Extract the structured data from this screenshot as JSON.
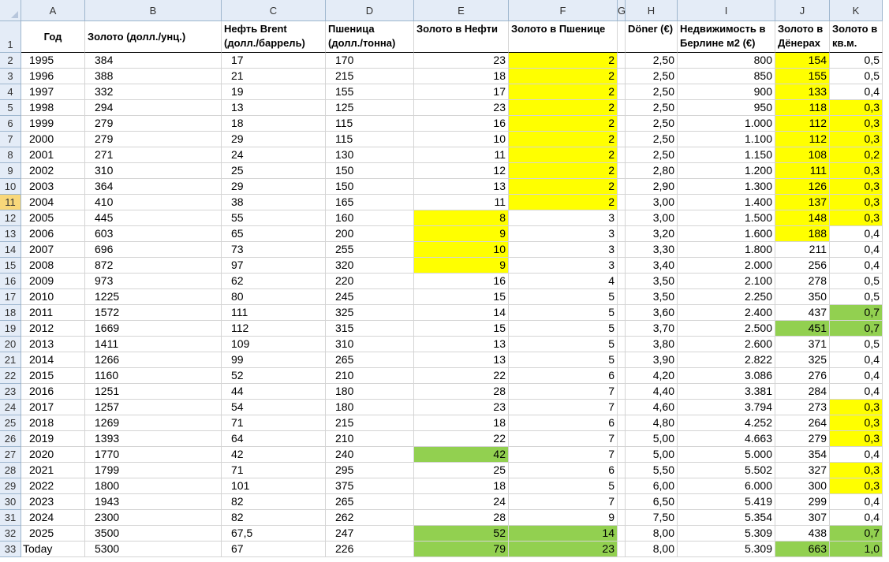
{
  "columns": [
    "A",
    "B",
    "C",
    "D",
    "E",
    "F",
    "G",
    "H",
    "I",
    "J",
    "K"
  ],
  "headers": {
    "A": "Год",
    "B": "Золото (долл./унц.)",
    "C": "Нефть Brent (долл./баррель)",
    "D": "Пшеница (долл./тонна)",
    "E": "Золото в Нефти",
    "F": "Золото в Пшенице",
    "G": "",
    "H": "Döner (€)",
    "I": "Недвижимость в Берлине м2 (€)",
    "J": "Золото в Дёнерах",
    "K": "Золото в кв.м."
  },
  "row_numbers": [
    "1",
    "2",
    "3",
    "4",
    "5",
    "6",
    "7",
    "8",
    "9",
    "10",
    "11",
    "12",
    "13",
    "14",
    "15",
    "16",
    "17",
    "18",
    "19",
    "20",
    "21",
    "22",
    "23",
    "24",
    "25",
    "26",
    "27",
    "28",
    "29",
    "30",
    "31",
    "32",
    "33"
  ],
  "active_row": "11",
  "colors": {
    "yellow": "#ffff00",
    "green": "#92d050",
    "header_bg": "#e4ecf7",
    "active_header": "#f8d77a"
  },
  "rows": [
    [
      "1995",
      "384",
      "17",
      "170",
      "23",
      "2",
      "2,50",
      "800",
      "154",
      "0,5"
    ],
    [
      "1996",
      "388",
      "21",
      "215",
      "18",
      "2",
      "2,50",
      "850",
      "155",
      "0,5"
    ],
    [
      "1997",
      "332",
      "19",
      "155",
      "17",
      "2",
      "2,50",
      "900",
      "133",
      "0,4"
    ],
    [
      "1998",
      "294",
      "13",
      "125",
      "23",
      "2",
      "2,50",
      "950",
      "118",
      "0,3"
    ],
    [
      "1999",
      "279",
      "18",
      "115",
      "16",
      "2",
      "2,50",
      "1.000",
      "112",
      "0,3"
    ],
    [
      "2000",
      "279",
      "29",
      "115",
      "10",
      "2",
      "2,50",
      "1.100",
      "112",
      "0,3"
    ],
    [
      "2001",
      "271",
      "24",
      "130",
      "11",
      "2",
      "2,50",
      "1.150",
      "108",
      "0,2"
    ],
    [
      "2002",
      "310",
      "25",
      "150",
      "12",
      "2",
      "2,80",
      "1.200",
      "111",
      "0,3"
    ],
    [
      "2003",
      "364",
      "29",
      "150",
      "13",
      "2",
      "2,90",
      "1.300",
      "126",
      "0,3"
    ],
    [
      "2004",
      "410",
      "38",
      "165",
      "11",
      "2",
      "3,00",
      "1.400",
      "137",
      "0,3"
    ],
    [
      "2005",
      "445",
      "55",
      "160",
      "8",
      "3",
      "3,00",
      "1.500",
      "148",
      "0,3"
    ],
    [
      "2006",
      "603",
      "65",
      "200",
      "9",
      "3",
      "3,20",
      "1.600",
      "188",
      "0,4"
    ],
    [
      "2007",
      "696",
      "73",
      "255",
      "10",
      "3",
      "3,30",
      "1.800",
      "211",
      "0,4"
    ],
    [
      "2008",
      "872",
      "97",
      "320",
      "9",
      "3",
      "3,40",
      "2.000",
      "256",
      "0,4"
    ],
    [
      "2009",
      "973",
      "62",
      "220",
      "16",
      "4",
      "3,50",
      "2.100",
      "278",
      "0,5"
    ],
    [
      "2010",
      "1225",
      "80",
      "245",
      "15",
      "5",
      "3,50",
      "2.250",
      "350",
      "0,5"
    ],
    [
      "2011",
      "1572",
      "111",
      "325",
      "14",
      "5",
      "3,60",
      "2.400",
      "437",
      "0,7"
    ],
    [
      "2012",
      "1669",
      "112",
      "315",
      "15",
      "5",
      "3,70",
      "2.500",
      "451",
      "0,7"
    ],
    [
      "2013",
      "1411",
      "109",
      "310",
      "13",
      "5",
      "3,80",
      "2.600",
      "371",
      "0,5"
    ],
    [
      "2014",
      "1266",
      "99",
      "265",
      "13",
      "5",
      "3,90",
      "2.822",
      "325",
      "0,4"
    ],
    [
      "2015",
      "1160",
      "52",
      "210",
      "22",
      "6",
      "4,20",
      "3.086",
      "276",
      "0,4"
    ],
    [
      "2016",
      "1251",
      "44",
      "180",
      "28",
      "7",
      "4,40",
      "3.381",
      "284",
      "0,4"
    ],
    [
      "2017",
      "1257",
      "54",
      "180",
      "23",
      "7",
      "4,60",
      "3.794",
      "273",
      "0,3"
    ],
    [
      "2018",
      "1269",
      "71",
      "215",
      "18",
      "6",
      "4,80",
      "4.252",
      "264",
      "0,3"
    ],
    [
      "2019",
      "1393",
      "64",
      "210",
      "22",
      "7",
      "5,00",
      "4.663",
      "279",
      "0,3"
    ],
    [
      "2020",
      "1770",
      "42",
      "240",
      "42",
      "7",
      "5,00",
      "5.000",
      "354",
      "0,4"
    ],
    [
      "2021",
      "1799",
      "71",
      "295",
      "25",
      "6",
      "5,50",
      "5.502",
      "327",
      "0,3"
    ],
    [
      "2022",
      "1800",
      "101",
      "375",
      "18",
      "5",
      "6,00",
      "6.000",
      "300",
      "0,3"
    ],
    [
      "2023",
      "1943",
      "82",
      "265",
      "24",
      "7",
      "6,50",
      "5.419",
      "299",
      "0,4"
    ],
    [
      "2024",
      "2300",
      "82",
      "262",
      "28",
      "9",
      "7,50",
      "5.354",
      "307",
      "0,4"
    ],
    [
      "2025",
      "3500",
      "67,5",
      "247",
      "52",
      "14",
      "8,00",
      "5.309",
      "438",
      "0,7"
    ],
    [
      "Today",
      "5300",
      "67",
      "226",
      "79",
      "23",
      "8,00",
      "5.309",
      "663",
      "1,0"
    ]
  ],
  "highlights": {
    "E": {
      "yellow": [
        "2005",
        "2006",
        "2007",
        "2008"
      ],
      "green": [
        "2020",
        "2025",
        "Today"
      ]
    },
    "F": {
      "yellow": [
        "1995",
        "1996",
        "1997",
        "1998",
        "1999",
        "2000",
        "2001",
        "2002",
        "2003",
        "2004"
      ],
      "green": [
        "2025",
        "Today"
      ]
    },
    "J": {
      "yellow": [
        "1995",
        "1996",
        "1997",
        "1998",
        "1999",
        "2000",
        "2001",
        "2002",
        "2003",
        "2004",
        "2005",
        "2006"
      ],
      "green": [
        "2012",
        "Today"
      ]
    },
    "K": {
      "yellow": [
        "1998",
        "1999",
        "2000",
        "2001",
        "2002",
        "2003",
        "2004",
        "2005",
        "2017",
        "2018",
        "2019",
        "2021",
        "2022"
      ],
      "green": [
        "2011",
        "2012",
        "2025",
        "Today"
      ]
    }
  }
}
